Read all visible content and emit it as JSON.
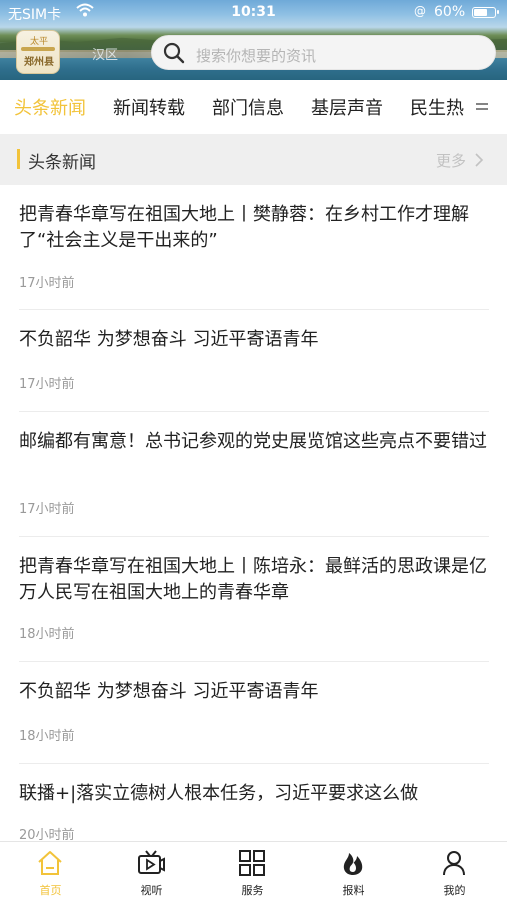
{
  "status_bar": {
    "carrier": "无SIM卡",
    "time": "10:31",
    "location_glyph": "@",
    "battery": "60%",
    "battery_level_percent": 60
  },
  "header": {
    "logo_top_text": "太平",
    "logo_text": "郑州县",
    "region_label": "汉区",
    "search_placeholder": "搜索你想要的资讯"
  },
  "tabs": [
    {
      "label": "头条新闻",
      "active": true
    },
    {
      "label": "新闻转载",
      "active": false
    },
    {
      "label": "部门信息",
      "active": false
    },
    {
      "label": "基层声音",
      "active": false
    },
    {
      "label": "民生热",
      "active": false
    }
  ],
  "section": {
    "title": "头条新闻",
    "more": "更多"
  },
  "news": [
    {
      "headline": "把青春华章写在祖国大地上丨樊静蓉：在乡村工作才理解了“社会主义是干出来的”",
      "time": "17小时前"
    },
    {
      "headline": "不负韶华 为梦想奋斗 习近平寄语青年",
      "time": "17小时前"
    },
    {
      "headline": "邮编都有寓意！总书记参观的党史展览馆这些亮点不要错过",
      "time": "17小时前"
    },
    {
      "headline": "把青春华章写在祖国大地上丨陈培永：最鲜活的思政课是亿万人民写在祖国大地上的青春华章",
      "time": "18小时前"
    },
    {
      "headline": "不负韶华 为梦想奋斗 习近平寄语青年",
      "time": "18小时前"
    },
    {
      "headline": "联播+|落实立德树人根本任务，习近平要求这么做",
      "time": "20小时前"
    }
  ],
  "tabbar": [
    {
      "label": "首页",
      "icon": "home-icon",
      "active": true
    },
    {
      "label": "视听",
      "icon": "tv-icon",
      "active": false
    },
    {
      "label": "服务",
      "icon": "grid-icon",
      "active": false
    },
    {
      "label": "报料",
      "icon": "flame-icon",
      "active": false
    },
    {
      "label": "我的",
      "icon": "user-icon",
      "active": false
    }
  ],
  "colors": {
    "accent": "#f2c33a",
    "text": "#222222",
    "muted": "#9a9a9a",
    "section_bg": "#efefef"
  }
}
